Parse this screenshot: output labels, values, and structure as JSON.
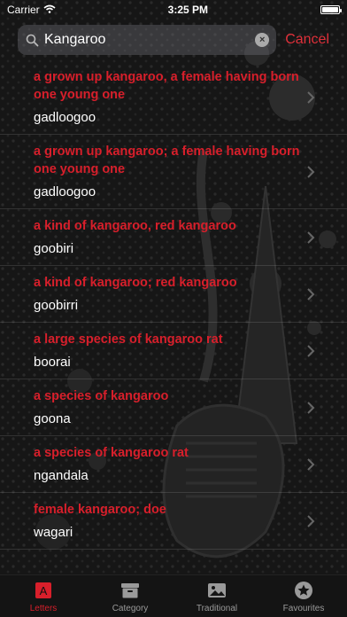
{
  "status": {
    "carrier": "Carrier",
    "time": "3:25 PM"
  },
  "search": {
    "value": "Kangaroo",
    "cancel_label": "Cancel"
  },
  "colors": {
    "accent": "#d81f2b",
    "text": "#ffffff"
  },
  "results": [
    {
      "english": "a grown up kangaroo, a female having born one young one",
      "word": "gadloogoo"
    },
    {
      "english": "a grown up kangaroo; a female having born one young one",
      "word": "gadloogoo"
    },
    {
      "english": "a kind of kangaroo, red kangaroo",
      "word": "goobiri"
    },
    {
      "english": "a kind of kangaroo; red kangaroo",
      "word": "goobirri"
    },
    {
      "english": "a large species of kangaroo rat",
      "word": "boorai"
    },
    {
      "english": "a species of kangaroo",
      "word": "goona"
    },
    {
      "english": "a species of kangaroo rat",
      "word": "ngandala"
    },
    {
      "english": "female kangaroo; doe",
      "word": "wagari"
    }
  ],
  "tabs": [
    {
      "label": "Letters",
      "icon": "letter-a-icon",
      "active": true
    },
    {
      "label": "Category",
      "icon": "archive-box-icon",
      "active": false
    },
    {
      "label": "Traditional",
      "icon": "photo-icon",
      "active": false
    },
    {
      "label": "Favourites",
      "icon": "star-circle-icon",
      "active": false
    }
  ]
}
